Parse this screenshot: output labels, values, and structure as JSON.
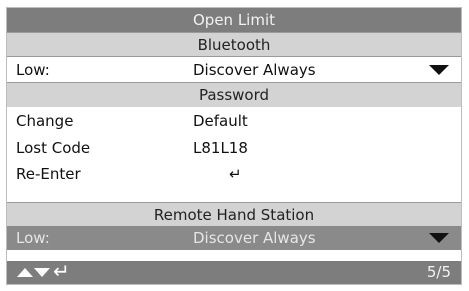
{
  "title": "Open Limit",
  "sections": {
    "bluetooth": "Bluetooth",
    "password": "Password",
    "remote_hand_station": "Remote Hand Station"
  },
  "bluetooth_row": {
    "label": "Low:",
    "value": "Discover Always"
  },
  "password_rows": [
    {
      "label": "Change",
      "value": "Default"
    },
    {
      "label": "Lost Code",
      "value": "L81L18"
    },
    {
      "label": "Re-Enter",
      "value": "↵"
    }
  ],
  "remote_row": {
    "label": "Low:",
    "value": "Discover Always"
  },
  "footer": {
    "enter_glyph": "↵",
    "page": "5/5"
  },
  "colors": {
    "title_bar": "#7d7d7d",
    "section_bg": "#d3d3d3",
    "selected_bg": "#8a8a8a"
  },
  "icons": [
    "dropdown-arrow-icon",
    "up-arrow-icon",
    "down-arrow-icon",
    "enter-icon"
  ]
}
